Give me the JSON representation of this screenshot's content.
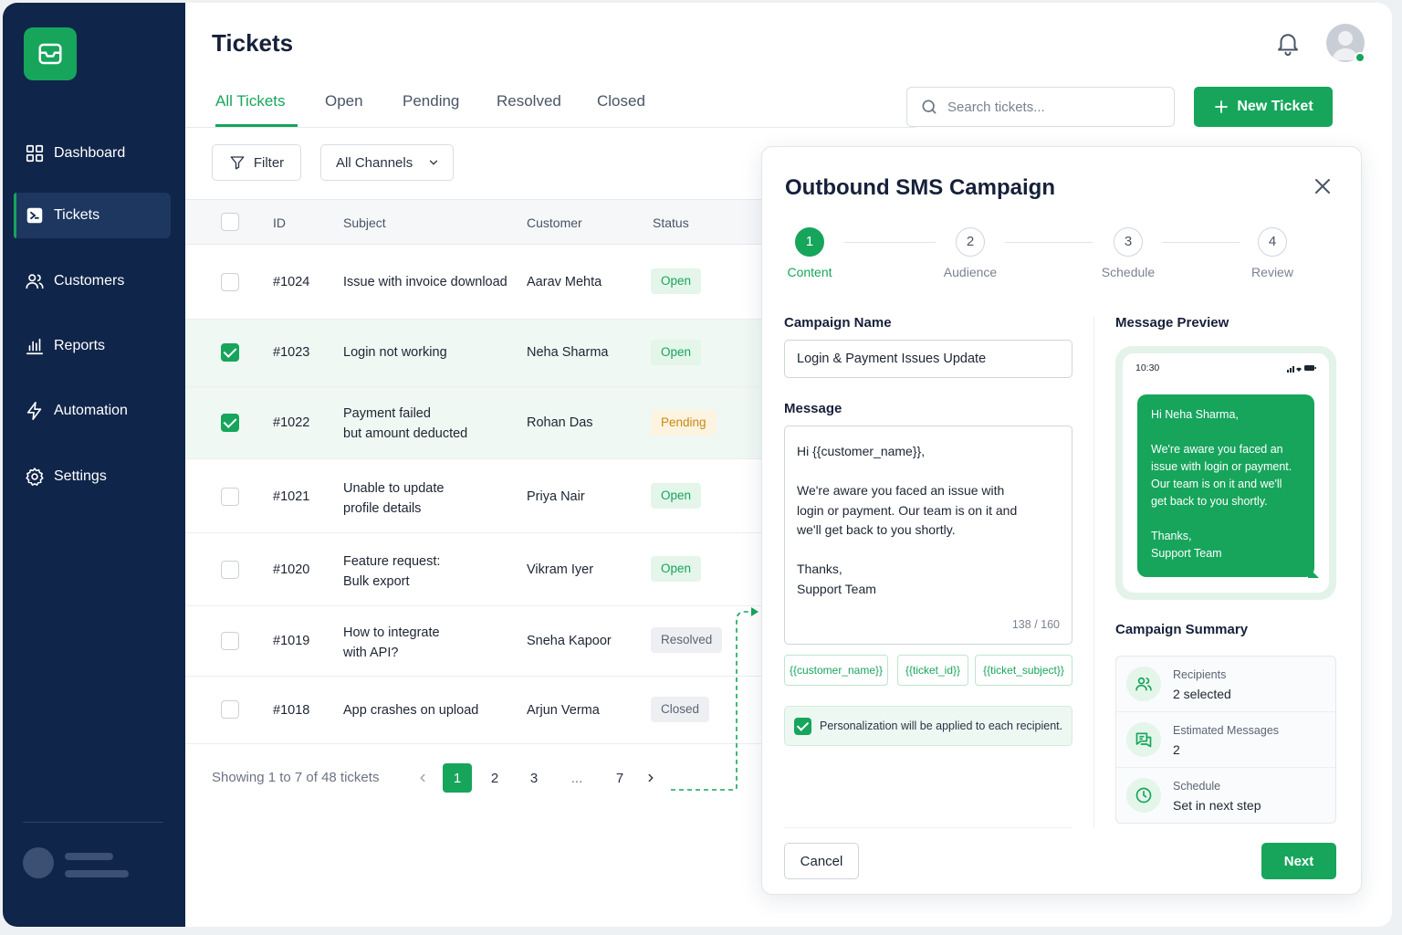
{
  "sidebar": {
    "items": [
      {
        "label": "Dashboard",
        "icon": "grid-icon"
      },
      {
        "label": "Tickets",
        "icon": "ticket-icon",
        "active": true
      },
      {
        "label": "Customers",
        "icon": "users-icon"
      },
      {
        "label": "Reports",
        "icon": "bar-chart-icon"
      },
      {
        "label": "Automation",
        "icon": "bolt-icon"
      },
      {
        "label": "Settings",
        "icon": "gear-icon"
      }
    ]
  },
  "header": {
    "title": "Tickets",
    "search_placeholder": "Search tickets...",
    "new_ticket_label": "New Ticket"
  },
  "tabs": [
    {
      "label": "All Tickets",
      "active": true
    },
    {
      "label": "Open"
    },
    {
      "label": "Pending"
    },
    {
      "label": "Resolved"
    },
    {
      "label": "Closed"
    }
  ],
  "toolbar": {
    "filter_label": "Filter",
    "channel_selected": "All Channels"
  },
  "table": {
    "columns": [
      "ID",
      "Subject",
      "Customer",
      "Status"
    ],
    "rows": [
      {
        "id": "#1024",
        "subject": [
          "Issue with invoice download"
        ],
        "customer": "Aarav Mehta",
        "status": "Open",
        "checked": false
      },
      {
        "id": "#1023",
        "subject": [
          "Login not working"
        ],
        "customer": "Neha Sharma",
        "status": "Open",
        "checked": true
      },
      {
        "id": "#1022",
        "subject": [
          "Payment failed",
          "but amount deducted"
        ],
        "customer": "Rohan Das",
        "status": "Pending",
        "checked": true
      },
      {
        "id": "#1021",
        "subject": [
          "Unable to update",
          "profile details"
        ],
        "customer": "Priya Nair",
        "status": "Open",
        "checked": false
      },
      {
        "id": "#1020",
        "subject": [
          "Feature request:",
          "Bulk export"
        ],
        "customer": "Vikram Iyer",
        "status": "Open",
        "checked": false
      },
      {
        "id": "#1019",
        "subject": [
          "How to integrate",
          "with API?"
        ],
        "customer": "Sneha Kapoor",
        "status": "Resolved",
        "checked": false
      },
      {
        "id": "#1018",
        "subject": [
          "App crashes on upload"
        ],
        "customer": "Arjun Verma",
        "status": "Closed",
        "checked": false
      }
    ]
  },
  "pagination": {
    "showing": "Showing 1 to 7 of 48 tickets",
    "pages": [
      "1",
      "2",
      "3",
      "...",
      "7"
    ],
    "current": "1"
  },
  "modal": {
    "title": "Outbound SMS Campaign",
    "steps": [
      {
        "num": "1",
        "label": "Content",
        "active": true
      },
      {
        "num": "2",
        "label": "Audience"
      },
      {
        "num": "3",
        "label": "Schedule"
      },
      {
        "num": "4",
        "label": "Review"
      }
    ],
    "campaign_name_label": "Campaign Name",
    "campaign_name_value": "Login & Payment Issues Update",
    "message_label": "Message",
    "message_lines": [
      "Hi {{customer_name}},",
      "",
      "We're aware you faced an issue with",
      "login or payment. Our team is on it and",
      "we'll get back to you shortly.",
      "",
      "Thanks,",
      "Support Team"
    ],
    "message_count": "138 / 160",
    "chips": [
      "{{customer_name}}",
      "{{ticket_id}}",
      "{{ticket_subject}}"
    ],
    "notice": "Personalization will be applied to each recipient.",
    "preview_label": "Message Preview",
    "preview_time": "10:30",
    "preview_lines": [
      "Hi Neha Sharma,",
      "",
      "We're aware you faced an",
      "issue with login or payment.",
      "Our team is on it and we'll",
      "get back to you shortly.",
      "",
      "Thanks,",
      "Support Team"
    ],
    "summary_label": "Campaign Summary",
    "summary": [
      {
        "key": "Recipients",
        "value": "2 selected",
        "icon": "users-icon"
      },
      {
        "key": "Estimated Messages",
        "value": "2",
        "icon": "message-icon"
      },
      {
        "key": "Schedule",
        "value": "Set in next step",
        "icon": "clock-icon"
      }
    ],
    "cancel_label": "Cancel",
    "next_label": "Next"
  },
  "colors": {
    "accent": "#17a55c",
    "sidebar": "#10254a",
    "pending": "#c98a12"
  }
}
